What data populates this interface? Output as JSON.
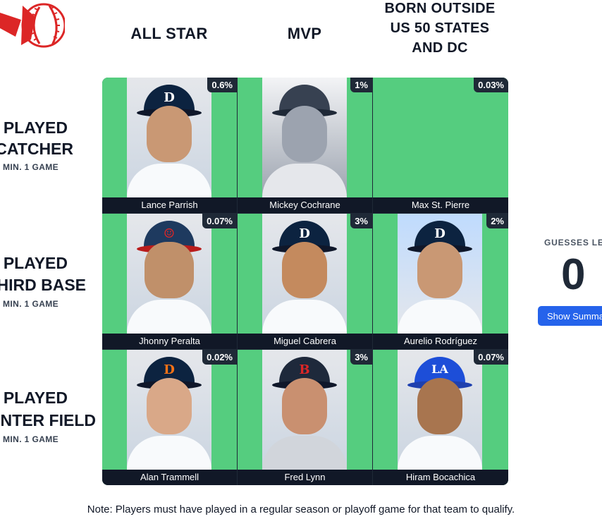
{
  "colors": {
    "cell_green": "#55cd7f",
    "grid_border": "#1f2937",
    "logo_red": "#dc2626",
    "button_blue": "#2563eb"
  },
  "logo": {
    "icon": "baseball-icon"
  },
  "columns": [
    {
      "label": "ALL STAR"
    },
    {
      "label": "MVP"
    },
    {
      "label_lines": [
        "BORN OUTSIDE",
        "US 50 STATES",
        "AND DC"
      ]
    }
  ],
  "rows": [
    {
      "label_lines": [
        "PLAYED",
        "CATCHER"
      ],
      "sub": "MIN. 1 GAME"
    },
    {
      "label_lines": [
        "PLAYED",
        "HIRD BASE"
      ],
      "sub": "MIN. 1 GAME"
    },
    {
      "label_lines": [
        "PLAYED",
        "NTER FIELD"
      ],
      "sub": "MIN. 1 GAME"
    }
  ],
  "cells": [
    [
      {
        "name": "Lance Parrish",
        "pct": "0.6%",
        "cap": "D",
        "cap_color": "#0c2340"
      },
      {
        "name": "Mickey Cochrane",
        "pct": "1%",
        "cap": "",
        "cap_color": "#374151"
      },
      {
        "name": "Max St. Pierre",
        "pct": "0.03%",
        "cap": "",
        "cap_color": ""
      }
    ],
    [
      {
        "name": "Jhonny Peralta",
        "pct": "0.07%",
        "cap": "☺",
        "cap_color": "#1e3a5f"
      },
      {
        "name": "Miguel Cabrera",
        "pct": "3%",
        "cap": "D",
        "cap_color": "#0c2340"
      },
      {
        "name": "Aurelio Rodríguez",
        "pct": "2%",
        "cap": "D",
        "cap_color": "#0c2340"
      }
    ],
    [
      {
        "name": "Alan Trammell",
        "pct": "0.02%",
        "cap": "D",
        "cap_color": "#0c2340"
      },
      {
        "name": "Fred Lynn",
        "pct": "3%",
        "cap": "B",
        "cap_color": "#1e293b"
      },
      {
        "name": "Hiram Bocachica",
        "pct": "0.07%",
        "cap": "LA",
        "cap_color": "#1d4ed8"
      }
    ]
  ],
  "guesses": {
    "label": "GUESSES LEF",
    "value": "0"
  },
  "summary_button": {
    "label": "Show Summar"
  },
  "note": "Note: Players must have played in a regular season or playoff game for that team to qualify."
}
